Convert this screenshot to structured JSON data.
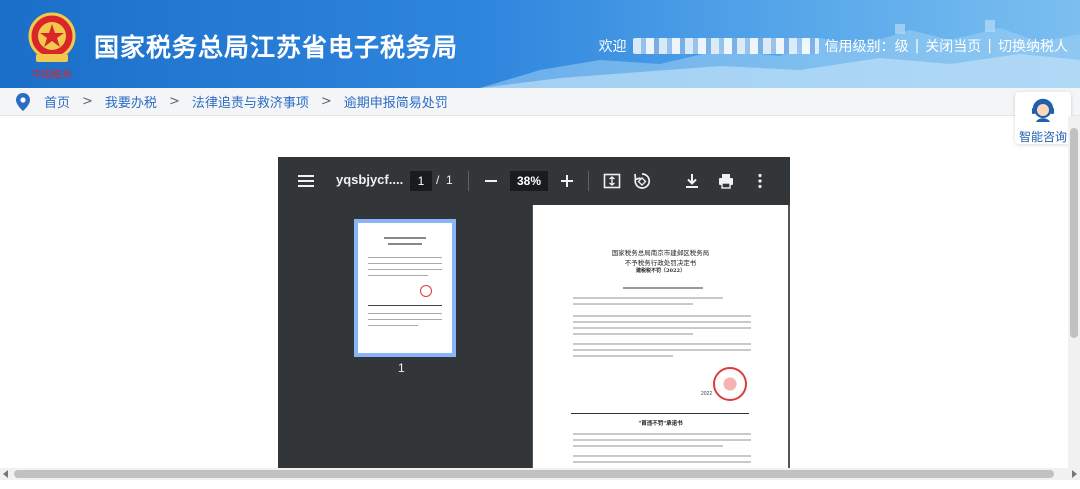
{
  "header": {
    "title": "国家税务总局江苏省电子税务局",
    "logo_text": "中国税务",
    "welcome": "欢迎",
    "credit_label": "信用级别：",
    "credit_value": "级",
    "close_page": "关闭当页",
    "switch_taxpayer": "切换纳税人"
  },
  "breadcrumb": {
    "items": [
      "首页",
      "我要办税",
      "法律追责与救济事项",
      "逾期申报简易处罚"
    ],
    "separator": ">"
  },
  "consult": {
    "label": "智能咨询"
  },
  "pdf": {
    "filename": "yqsbjycf....",
    "current_page": "1",
    "page_sep": "/",
    "total_pages": "1",
    "zoom": "38%",
    "thumbnail_number": "1",
    "doc_title_1": "国家税务总局南京市建邺区税务局",
    "doc_title_2": "不予税务行政处罚决定书",
    "doc_number": "建税税不罚〔2022〕",
    "stamp_year": "2022",
    "section_title": "\"首违不罚\"承诺书"
  },
  "colors": {
    "header_start": "#1b6fc9",
    "header_end": "#7cbff0",
    "link": "#2b6cc4",
    "pdf_toolbar": "#323639",
    "stamp_red": "#e03a3a"
  }
}
